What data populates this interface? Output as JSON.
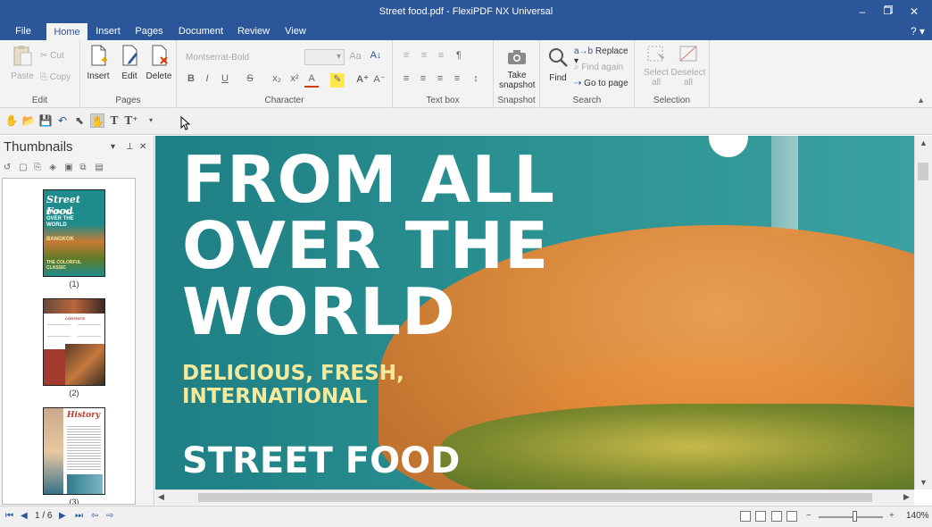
{
  "window": {
    "title": "Street food.pdf - FlexiPDF NX Universal",
    "minimize": "–",
    "restore": "🗗",
    "close": "✕"
  },
  "tabs": [
    "File",
    "Home",
    "Insert",
    "Pages",
    "Document",
    "Review",
    "View"
  ],
  "active_tab": "Home",
  "help": "? ▾",
  "ribbon": {
    "edit": {
      "label": "Edit",
      "paste": "Paste",
      "cut": "Cut",
      "copy": "Copy"
    },
    "pages": {
      "label": "Pages",
      "insert": "Insert",
      "edit": "Edit",
      "delete": "Delete"
    },
    "character": {
      "label": "Character",
      "font": "Montserrat-Bold",
      "size": ""
    },
    "textbox": {
      "label": "Text box"
    },
    "snapshot": {
      "label": "Snapshot",
      "take_line1": "Take",
      "take_line2": "snapshot"
    },
    "search": {
      "label": "Search",
      "find": "Find",
      "replace": "Replace ▾",
      "find_again": "Find again",
      "go_to_page": "Go to page"
    },
    "selection": {
      "label": "Selection",
      "select_line1": "Select",
      "select_line2": "all",
      "deselect_line1": "Deselect",
      "deselect_line2": "all"
    }
  },
  "thumbnails": {
    "title": "Thumbnails",
    "pin": "▾ ᵽ ✕",
    "pages": [
      {
        "num": "(1)",
        "title": "Street Food",
        "lines": [
          "FROM ALL",
          "OVER THE",
          "WORLD"
        ],
        "city": "BANGKOK",
        "sub": "THE COLORFUL CLASSIC"
      },
      {
        "num": "(2)",
        "title": "CONTENTS"
      },
      {
        "num": "(3)",
        "title": "History"
      }
    ]
  },
  "document": {
    "headline": [
      "FROM ALL",
      "OVER THE",
      "WORLD"
    ],
    "tagline": [
      "DELICIOUS, FRESH,",
      "INTERNATIONAL"
    ],
    "footer": "STREET FOOD"
  },
  "status": {
    "page_indicator": "1 / 6",
    "zoom": "140%",
    "zoom_fraction": 0.55
  },
  "colors": {
    "accent": "#2b579a",
    "hero_text": "#ffffff",
    "tagline": "#f5ea9c"
  }
}
